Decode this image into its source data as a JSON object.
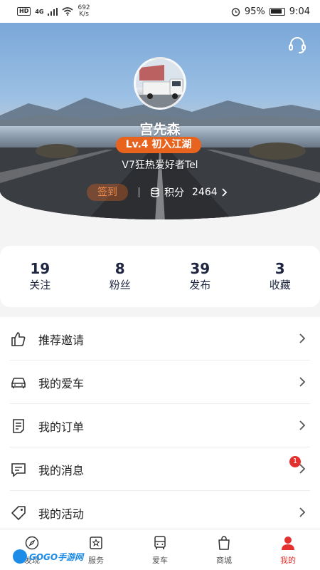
{
  "status_bar": {
    "hd": "HD",
    "network": "4G",
    "speed_value": "692",
    "speed_unit": "K/s",
    "battery": "95%",
    "time": "9:04"
  },
  "profile": {
    "name": "宫先森",
    "level": "Lv.4 初入江湖",
    "tag": "V7狂热爱好者Tel",
    "checkin_label": "签到",
    "points_label": "积分",
    "points_value": "2464"
  },
  "stats": [
    {
      "value": "19",
      "label": "关注"
    },
    {
      "value": "8",
      "label": "粉丝"
    },
    {
      "value": "39",
      "label": "发布"
    },
    {
      "value": "3",
      "label": "收藏"
    }
  ],
  "menu": [
    {
      "label": "推荐邀请",
      "icon": "thumbs-up-icon"
    },
    {
      "label": "我的爱车",
      "icon": "car-icon"
    },
    {
      "label": "我的订单",
      "icon": "order-icon"
    },
    {
      "label": "我的消息",
      "icon": "message-icon",
      "badge": "1"
    },
    {
      "label": "我的活动",
      "icon": "tag-icon"
    }
  ],
  "tabs": [
    {
      "label": "发现",
      "icon": "compass-icon"
    },
    {
      "label": "服务",
      "icon": "service-icon"
    },
    {
      "label": "爱车",
      "icon": "truck-icon"
    },
    {
      "label": "商城",
      "icon": "bag-icon"
    },
    {
      "label": "我的",
      "icon": "person-icon",
      "active": true
    }
  ],
  "watermark": "GOGO手游网",
  "colors": {
    "accent": "#e8631e",
    "active_tab": "#e4312f",
    "stat_text": "#1d2540"
  }
}
